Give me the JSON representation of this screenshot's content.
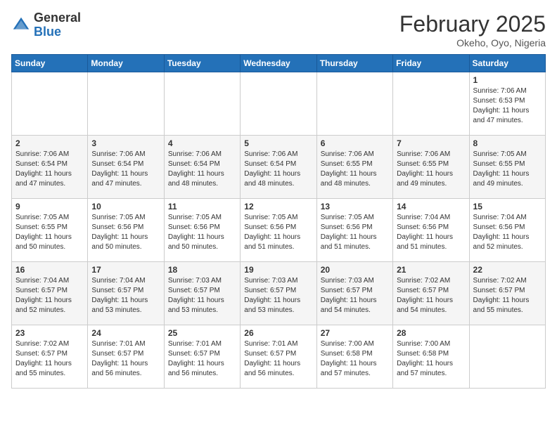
{
  "header": {
    "logo_general": "General",
    "logo_blue": "Blue",
    "month_title": "February 2025",
    "subtitle": "Okeho, Oyo, Nigeria"
  },
  "days_of_week": [
    "Sunday",
    "Monday",
    "Tuesday",
    "Wednesday",
    "Thursday",
    "Friday",
    "Saturday"
  ],
  "weeks": [
    [
      {
        "day": "",
        "info": ""
      },
      {
        "day": "",
        "info": ""
      },
      {
        "day": "",
        "info": ""
      },
      {
        "day": "",
        "info": ""
      },
      {
        "day": "",
        "info": ""
      },
      {
        "day": "",
        "info": ""
      },
      {
        "day": "1",
        "info": "Sunrise: 7:06 AM\nSunset: 6:53 PM\nDaylight: 11 hours\nand 47 minutes."
      }
    ],
    [
      {
        "day": "2",
        "info": "Sunrise: 7:06 AM\nSunset: 6:54 PM\nDaylight: 11 hours\nand 47 minutes."
      },
      {
        "day": "3",
        "info": "Sunrise: 7:06 AM\nSunset: 6:54 PM\nDaylight: 11 hours\nand 47 minutes."
      },
      {
        "day": "4",
        "info": "Sunrise: 7:06 AM\nSunset: 6:54 PM\nDaylight: 11 hours\nand 48 minutes."
      },
      {
        "day": "5",
        "info": "Sunrise: 7:06 AM\nSunset: 6:54 PM\nDaylight: 11 hours\nand 48 minutes."
      },
      {
        "day": "6",
        "info": "Sunrise: 7:06 AM\nSunset: 6:55 PM\nDaylight: 11 hours\nand 48 minutes."
      },
      {
        "day": "7",
        "info": "Sunrise: 7:06 AM\nSunset: 6:55 PM\nDaylight: 11 hours\nand 49 minutes."
      },
      {
        "day": "8",
        "info": "Sunrise: 7:05 AM\nSunset: 6:55 PM\nDaylight: 11 hours\nand 49 minutes."
      }
    ],
    [
      {
        "day": "9",
        "info": "Sunrise: 7:05 AM\nSunset: 6:55 PM\nDaylight: 11 hours\nand 50 minutes."
      },
      {
        "day": "10",
        "info": "Sunrise: 7:05 AM\nSunset: 6:56 PM\nDaylight: 11 hours\nand 50 minutes."
      },
      {
        "day": "11",
        "info": "Sunrise: 7:05 AM\nSunset: 6:56 PM\nDaylight: 11 hours\nand 50 minutes."
      },
      {
        "day": "12",
        "info": "Sunrise: 7:05 AM\nSunset: 6:56 PM\nDaylight: 11 hours\nand 51 minutes."
      },
      {
        "day": "13",
        "info": "Sunrise: 7:05 AM\nSunset: 6:56 PM\nDaylight: 11 hours\nand 51 minutes."
      },
      {
        "day": "14",
        "info": "Sunrise: 7:04 AM\nSunset: 6:56 PM\nDaylight: 11 hours\nand 51 minutes."
      },
      {
        "day": "15",
        "info": "Sunrise: 7:04 AM\nSunset: 6:56 PM\nDaylight: 11 hours\nand 52 minutes."
      }
    ],
    [
      {
        "day": "16",
        "info": "Sunrise: 7:04 AM\nSunset: 6:57 PM\nDaylight: 11 hours\nand 52 minutes."
      },
      {
        "day": "17",
        "info": "Sunrise: 7:04 AM\nSunset: 6:57 PM\nDaylight: 11 hours\nand 53 minutes."
      },
      {
        "day": "18",
        "info": "Sunrise: 7:03 AM\nSunset: 6:57 PM\nDaylight: 11 hours\nand 53 minutes."
      },
      {
        "day": "19",
        "info": "Sunrise: 7:03 AM\nSunset: 6:57 PM\nDaylight: 11 hours\nand 53 minutes."
      },
      {
        "day": "20",
        "info": "Sunrise: 7:03 AM\nSunset: 6:57 PM\nDaylight: 11 hours\nand 54 minutes."
      },
      {
        "day": "21",
        "info": "Sunrise: 7:02 AM\nSunset: 6:57 PM\nDaylight: 11 hours\nand 54 minutes."
      },
      {
        "day": "22",
        "info": "Sunrise: 7:02 AM\nSunset: 6:57 PM\nDaylight: 11 hours\nand 55 minutes."
      }
    ],
    [
      {
        "day": "23",
        "info": "Sunrise: 7:02 AM\nSunset: 6:57 PM\nDaylight: 11 hours\nand 55 minutes."
      },
      {
        "day": "24",
        "info": "Sunrise: 7:01 AM\nSunset: 6:57 PM\nDaylight: 11 hours\nand 56 minutes."
      },
      {
        "day": "25",
        "info": "Sunrise: 7:01 AM\nSunset: 6:57 PM\nDaylight: 11 hours\nand 56 minutes."
      },
      {
        "day": "26",
        "info": "Sunrise: 7:01 AM\nSunset: 6:57 PM\nDaylight: 11 hours\nand 56 minutes."
      },
      {
        "day": "27",
        "info": "Sunrise: 7:00 AM\nSunset: 6:58 PM\nDaylight: 11 hours\nand 57 minutes."
      },
      {
        "day": "28",
        "info": "Sunrise: 7:00 AM\nSunset: 6:58 PM\nDaylight: 11 hours\nand 57 minutes."
      },
      {
        "day": "",
        "info": ""
      }
    ]
  ]
}
